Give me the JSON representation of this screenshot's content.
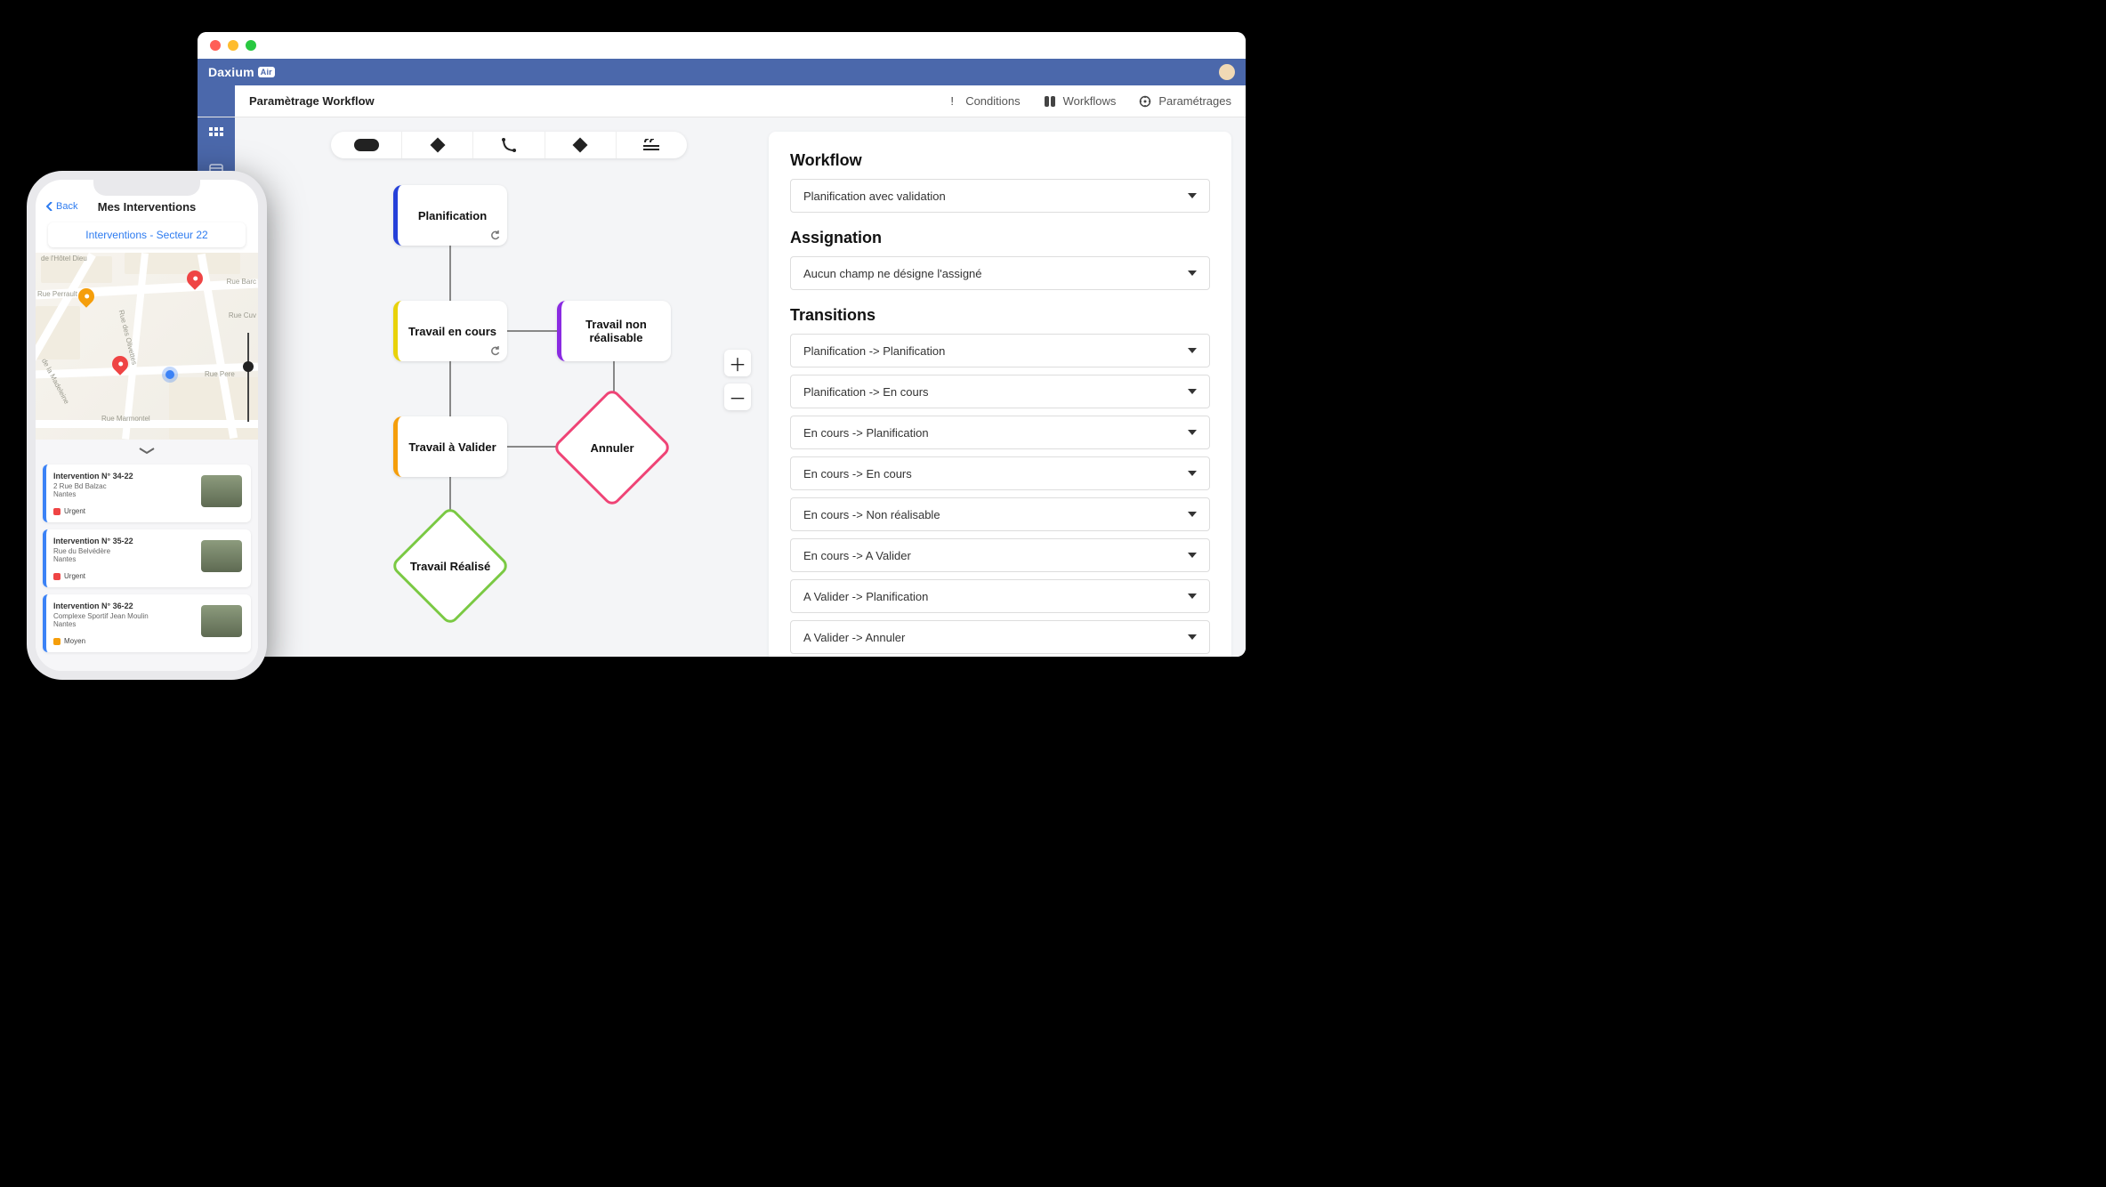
{
  "desktop": {
    "brand": "Daxium",
    "brand_suffix": "Air",
    "toolbar_title": "Paramètrage Workflow",
    "nav": {
      "conditions": "Conditions",
      "workflows": "Workflows",
      "parametrages": "Paramétrages"
    },
    "zoom": {
      "in": "＋",
      "out": "－"
    },
    "nodes": {
      "planification": "Planification",
      "travail_en_cours": "Travail en cours",
      "travail_non_realisable": "Travail non réalisable",
      "travail_a_valider": "Travail à Valider",
      "annuler": "Annuler",
      "travail_realise": "Travail Réalisé"
    },
    "panel": {
      "workflow_h": "Workflow",
      "workflow_sel": "Planification avec validation",
      "assignation_h": "Assignation",
      "assignation_sel": "Aucun champ ne désigne l'assigné",
      "transitions_h": "Transitions",
      "transitions": [
        "Planification -> Planification",
        "Planification -> En cours",
        "En cours -> Planification",
        "En cours -> En cours",
        "En cours -> Non réalisable",
        "En cours -> A Valider",
        "A Valider -> Planification",
        "A Valider -> Annuler"
      ]
    }
  },
  "phone": {
    "back": "Back",
    "title": "Mes Interventions",
    "search": "Interventions  - Secteur 22",
    "streets": {
      "hotel_dieu": "de l'Hôtel Dieu",
      "perrault": "Rue Perrault",
      "olivettes": "Rue des Olivettes",
      "barc": "Rue Barc",
      "cuv": "Rue Cuv",
      "madeleine": "de la Madeleine",
      "pere": "Rue Pere",
      "marmontel": "Rue Marmontel"
    },
    "cards": [
      {
        "title": "Intervention N° 34-22",
        "addr": "2 Rue Bd Balzac",
        "city": "Nantes",
        "prio": "Urgent",
        "prio_color": "red"
      },
      {
        "title": "Intervention N° 35-22",
        "addr": "Rue du Belvédère",
        "city": "Nantes",
        "prio": "Urgent",
        "prio_color": "red"
      },
      {
        "title": "Intervention N° 36-22",
        "addr": "Complexe Sportif Jean Moulin",
        "city": "Nantes",
        "prio": "Moyen",
        "prio_color": "orange"
      }
    ]
  }
}
